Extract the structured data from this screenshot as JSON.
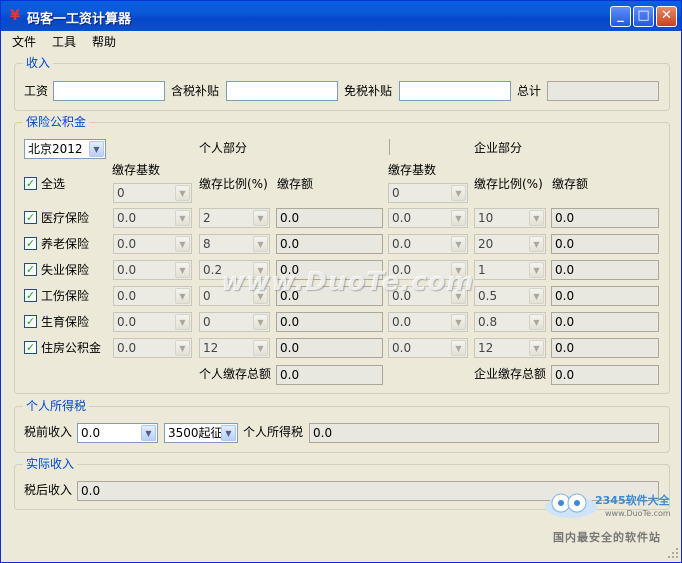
{
  "window": {
    "title": "码客一工资计算器",
    "icon": "app-logo-icon",
    "minimize": "_",
    "maximize": "□",
    "close": "✕"
  },
  "menu": [
    "文件",
    "工具",
    "帮助"
  ],
  "income": {
    "legend": "收入",
    "salary_label": "工资",
    "salary_value": "",
    "taxable_subsidy_label": "含税补贴",
    "taxable_subsidy_value": "",
    "taxfree_subsidy_label": "免税补贴",
    "taxfree_subsidy_value": "",
    "total_label": "总计",
    "total_value": ""
  },
  "insurance": {
    "legend": "保险公积金",
    "region": "北京2012",
    "personal_title": "个人部分",
    "company_title": "企业部分",
    "select_all_label": "全选",
    "col_base": "缴存基数",
    "col_ratio": "缴存比例(%)",
    "col_amount": "缴存额",
    "all_personal_base": "0",
    "all_company_base": "0",
    "rows": [
      {
        "label": "医疗保险",
        "p_base": "0.0",
        "p_ratio": "2",
        "p_amount": "0.0",
        "c_base": "0.0",
        "c_ratio": "10",
        "c_amount": "0.0"
      },
      {
        "label": "养老保险",
        "p_base": "0.0",
        "p_ratio": "8",
        "p_amount": "0.0",
        "c_base": "0.0",
        "c_ratio": "20",
        "c_amount": "0.0"
      },
      {
        "label": "失业保险",
        "p_base": "0.0",
        "p_ratio": "0.2",
        "p_amount": "0.0",
        "c_base": "0.0",
        "c_ratio": "1",
        "c_amount": "0.0"
      },
      {
        "label": "工伤保险",
        "p_base": "0.0",
        "p_ratio": "0",
        "p_amount": "0.0",
        "c_base": "0.0",
        "c_ratio": "0.5",
        "c_amount": "0.0"
      },
      {
        "label": "生育保险",
        "p_base": "0.0",
        "p_ratio": "0",
        "p_amount": "0.0",
        "c_base": "0.0",
        "c_ratio": "0.8",
        "c_amount": "0.0"
      },
      {
        "label": "住房公积金",
        "p_base": "0.0",
        "p_ratio": "12",
        "p_amount": "0.0",
        "c_base": "0.0",
        "c_ratio": "12",
        "c_amount": "0.0"
      }
    ],
    "personal_total_label": "个人缴存总额",
    "personal_total": "0.0",
    "company_total_label": "企业缴存总额",
    "company_total": "0.0"
  },
  "tax": {
    "legend": "个人所得税",
    "pretax_label": "税前收入",
    "pretax_value": "0.0",
    "threshold": "3500起征",
    "tax_label": "个人所得税",
    "tax_value": "0.0"
  },
  "actual": {
    "legend": "实际收入",
    "after_tax_label": "税后收入",
    "after_tax_value": "0.0"
  },
  "overlay": {
    "watermark": "www.DuoTe.com",
    "brand_name": "2345软件大全",
    "brand_url": "www.DuoTe.com",
    "brand_slogan": "国内最安全的软件站"
  },
  "colors": {
    "titlebar": "#0b58d6",
    "group_label": "#0046d5",
    "check": "#21a121",
    "window_bg": "#ece9d8"
  }
}
